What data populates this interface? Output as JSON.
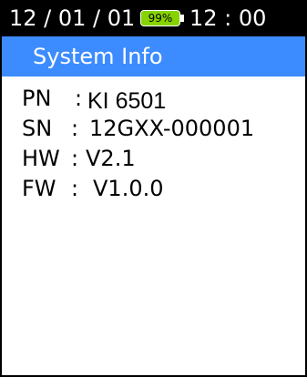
{
  "status_bar": {
    "date": "12 / 01 / 01",
    "battery_percent": "99%",
    "battery_level": 99,
    "time": "12 : 00"
  },
  "title_bar": {
    "title": "System Info"
  },
  "info": [
    {
      "label": "PN",
      "separator": ":",
      "value": "KI 6501"
    },
    {
      "label": "SN",
      "separator": ":",
      "value": "12GXX-000001"
    },
    {
      "label": "HW",
      "separator": ":",
      "value": "V2.1"
    },
    {
      "label": "FW",
      "separator": ":",
      "value": "V1.0.0"
    }
  ],
  "colors": {
    "status_bar_bg": "#000000",
    "title_bar_bg": "#3c8cff",
    "battery_fill": "#86d300",
    "text_light": "#ffffff",
    "text_dark": "#000000"
  }
}
